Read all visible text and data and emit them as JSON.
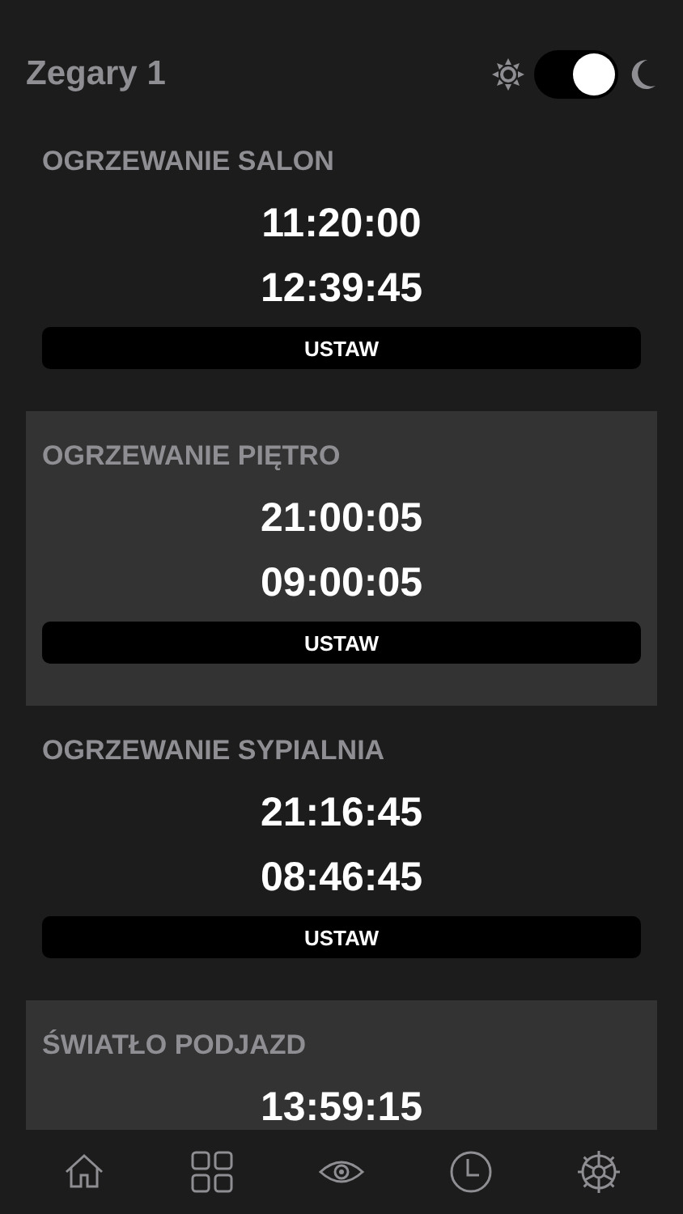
{
  "header": {
    "title": "Zegary 1",
    "dark_mode": true
  },
  "timers": [
    {
      "title": "OGRZEWANIE SALON",
      "highlighted": false,
      "times": [
        "11:20:00",
        "12:39:45"
      ],
      "button": "USTAW"
    },
    {
      "title": "OGRZEWANIE PIĘTRO",
      "highlighted": true,
      "times": [
        "21:00:05",
        "09:00:05"
      ],
      "button": "USTAW"
    },
    {
      "title": "OGRZEWANIE SYPIALNIA",
      "highlighted": false,
      "times": [
        "21:16:45",
        "08:46:45"
      ],
      "button": "USTAW"
    },
    {
      "title": "ŚWIATŁO PODJAZD",
      "highlighted": true,
      "times": [
        "13:59:15"
      ]
    }
  ],
  "tab_bar": {
    "items": [
      {
        "kind": "home"
      },
      {
        "kind": "grid"
      },
      {
        "kind": "eye"
      },
      {
        "kind": "clock"
      },
      {
        "kind": "gear"
      }
    ]
  }
}
